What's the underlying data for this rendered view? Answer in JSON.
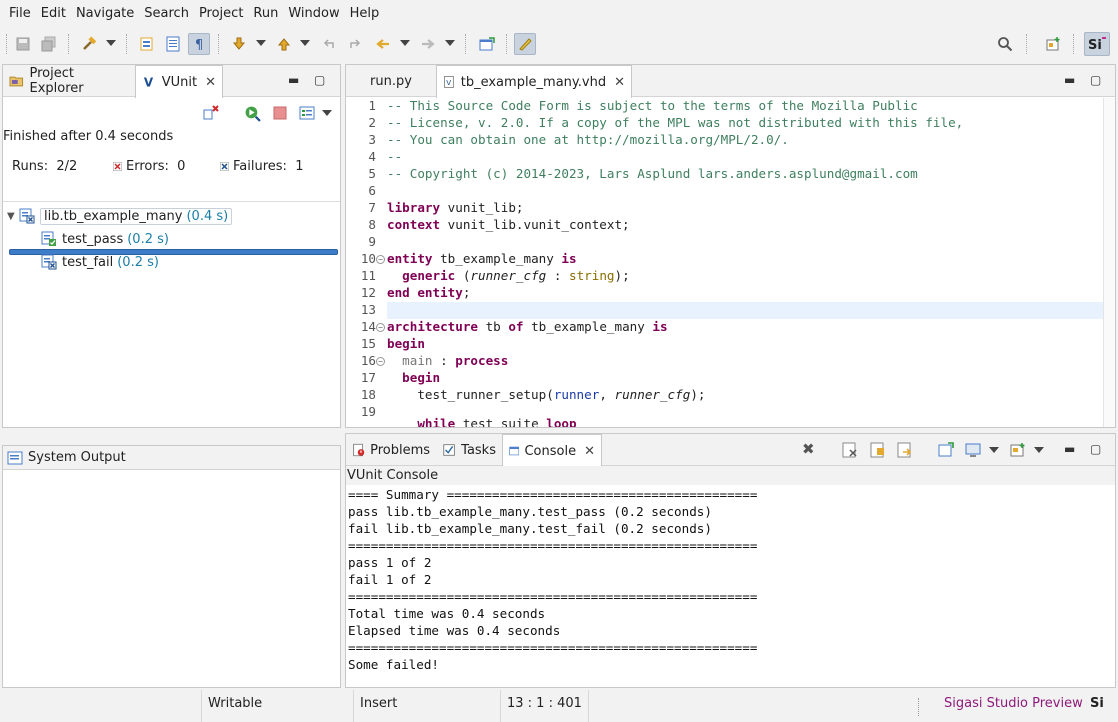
{
  "menu": [
    "File",
    "Edit",
    "Navigate",
    "Search",
    "Project",
    "Run",
    "Window",
    "Help"
  ],
  "left_tabs": {
    "project_explorer": "Project Explorer",
    "vunit": "VUnit"
  },
  "vunit": {
    "finished": "Finished after 0.4 seconds",
    "runs_label": "Runs:",
    "runs_value": "2/2",
    "errors_label": "Errors:",
    "errors_value": "0",
    "failures_label": "Failures:",
    "failures_value": "1",
    "progress_fraction": 1.0,
    "tree": {
      "root": {
        "name": "lib.tb_example_many",
        "time": "(0.4 s)"
      },
      "children": [
        {
          "name": "test_pass",
          "time": "(0.2 s)",
          "status": "pass"
        },
        {
          "name": "test_fail",
          "time": "(0.2 s)",
          "status": "fail"
        }
      ]
    }
  },
  "system_output": {
    "title": "System Output"
  },
  "editor": {
    "tabs": [
      {
        "label": "run.py"
      },
      {
        "label": "tb_example_many.vhd"
      }
    ],
    "line_numbers": [
      "1",
      "2",
      "3",
      "4",
      "5",
      "6",
      "7",
      "8",
      "9",
      "10",
      "11",
      "12",
      "13",
      "14",
      "15",
      "16",
      "17",
      "18",
      "19"
    ],
    "lines": {
      "l1": "-- This Source Code Form is subject to the terms of the Mozilla Public",
      "l2": "-- License, v. 2.0. If a copy of the MPL was not distributed with this file,",
      "l3": "-- You can obtain one at http://mozilla.org/MPL/2.0/.",
      "l4": "--",
      "l5": "-- Copyright (c) 2014-2023, Lars Asplund lars.anders.asplund@gmail.com",
      "l7a": "library",
      "l7b": " vunit_lib;",
      "l8a": "context",
      "l8b": " vunit_lib.vunit_context;",
      "l10a": "entity",
      "l10b": " tb_example_many ",
      "l10c": "is",
      "l11a": "  generic",
      "l11b": " (",
      "l11c": "runner_cfg",
      "l11d": " : ",
      "l11e": "string",
      "l11f": ");",
      "l12a": "end entity",
      "l12b": ";",
      "l14a": "architecture",
      "l14b": " tb ",
      "l14c": "of",
      "l14d": " tb_example_many ",
      "l14e": "is",
      "l15a": "begin",
      "l16a": "  main",
      "l16b": " : ",
      "l16c": "process",
      "l17a": "  begin",
      "l18a": "    test_runner_setup(",
      "l18b": "runner",
      "l18c": ", ",
      "l18d": "runner_cfg",
      "l18e": ");",
      "l20a": "    while",
      "l20b": " test_suite ",
      "l20c": "loop"
    }
  },
  "bottom_tabs": {
    "problems": "Problems",
    "tasks": "Tasks",
    "console": "Console"
  },
  "console": {
    "title": "VUnit Console",
    "lines": [
      "==== Summary =========================================",
      "pass lib.tb_example_many.test_pass (0.2 seconds)",
      "fail lib.tb_example_many.test_fail (0.2 seconds)",
      "======================================================",
      "pass 1 of 2",
      "fail 1 of 2",
      "======================================================",
      "Total time was 0.4 seconds",
      "Elapsed time was 0.4 seconds",
      "======================================================",
      "Some failed!"
    ]
  },
  "statusbar": {
    "writable": "Writable",
    "insert": "Insert",
    "position": "13 : 1 : 401",
    "product": "Sigasi Studio Preview",
    "logo": "Si"
  },
  "colors": {
    "progress": "#3d7cc9",
    "keyword": "#7f0055",
    "comment": "#3f7f5f",
    "time": "#1a7ea7",
    "product": "#8e1a7a"
  }
}
